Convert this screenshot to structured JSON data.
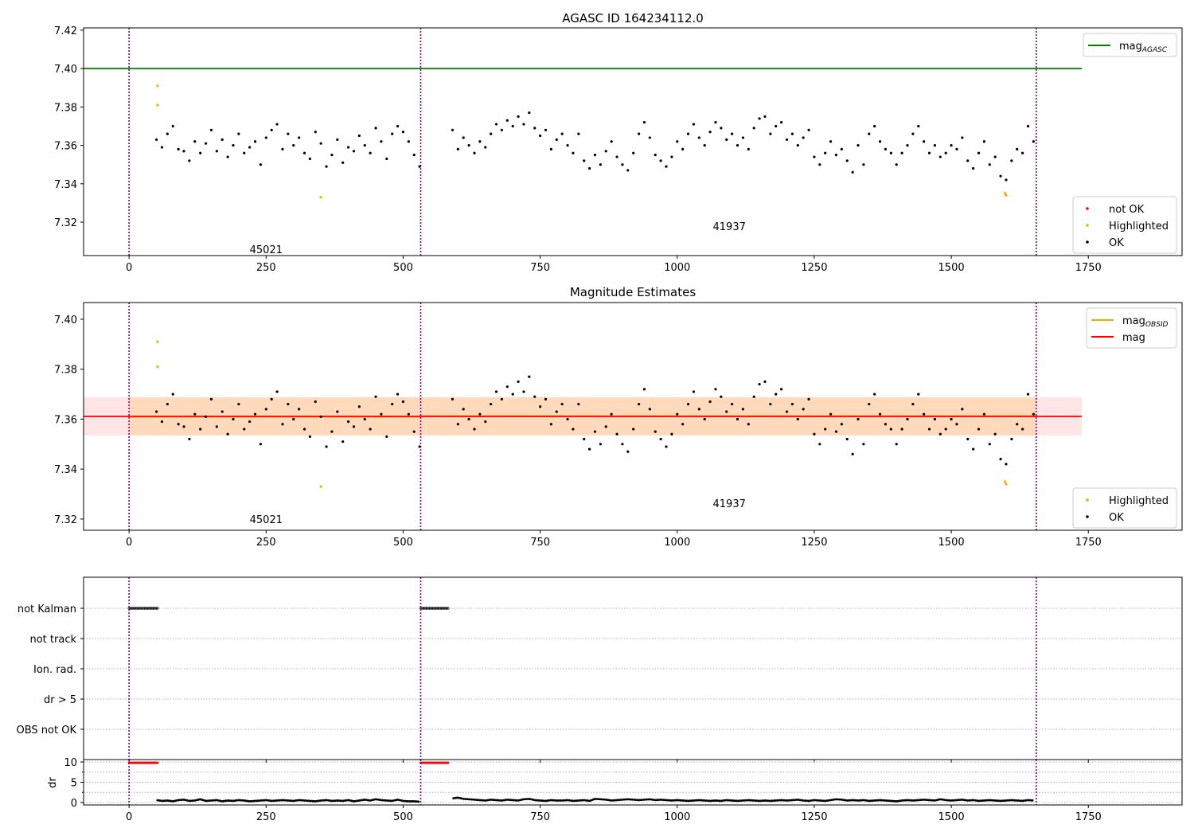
{
  "chart_data": {
    "type": "scatter",
    "xlim": [
      -83,
      1921
    ],
    "xticks": [
      0,
      250,
      500,
      750,
      1000,
      1250,
      1500,
      1750
    ],
    "obsid_boundaries": [
      0,
      532,
      1655
    ],
    "obsids": [
      {
        "id": "45021",
        "label_x": 250,
        "mag_obsid": 7.361,
        "x_start": 50,
        "x_step": 10,
        "mag": [
          7.363,
          7.359,
          7.366,
          7.37,
          7.358,
          7.357,
          7.352,
          7.362,
          7.356,
          7.361,
          7.368,
          7.357,
          7.363,
          7.354,
          7.36,
          7.366,
          7.356,
          7.359,
          7.362,
          7.35,
          7.364,
          7.368,
          7.371,
          7.358,
          7.366,
          7.36,
          7.364,
          7.356,
          7.353,
          7.367,
          7.361,
          7.349,
          7.355,
          7.363,
          7.351,
          7.359,
          7.357,
          7.365,
          7.36,
          7.356,
          7.369,
          7.362,
          7.353,
          7.366,
          7.37,
          7.367,
          7.362,
          7.355,
          7.349
        ],
        "dr": [
          0.6,
          0.4,
          0.5,
          0.3,
          0.6,
          0.7,
          0.4,
          0.5,
          0.8,
          0.4,
          0.5,
          0.6,
          0.3,
          0.5,
          0.4,
          0.6,
          0.5,
          0.3,
          0.4,
          0.5,
          0.6,
          0.4,
          0.5,
          0.6,
          0.5,
          0.4,
          0.6,
          0.5,
          0.4,
          0.3,
          0.5,
          0.6,
          0.4,
          0.5,
          0.4,
          0.6,
          0.3,
          0.5,
          0.7,
          0.5,
          0.8,
          0.6,
          0.5,
          0.4,
          0.7,
          0.4,
          0.3,
          0.3,
          0.2
        ],
        "not_kalman": [
          0,
          52
        ],
        "dr_clipped": [
          0,
          52
        ]
      },
      {
        "id": "41937",
        "label_x": 1095,
        "mag_obsid": 7.3612,
        "x_start": 590,
        "x_step": 10,
        "mag": [
          7.368,
          7.358,
          7.364,
          7.36,
          7.356,
          7.362,
          7.359,
          7.366,
          7.371,
          7.368,
          7.373,
          7.37,
          7.375,
          7.371,
          7.377,
          7.369,
          7.365,
          7.368,
          7.358,
          7.363,
          7.366,
          7.36,
          7.356,
          7.366,
          7.352,
          7.348,
          7.355,
          7.35,
          7.357,
          7.362,
          7.354,
          7.35,
          7.347,
          7.356,
          7.366,
          7.372,
          7.364,
          7.355,
          7.352,
          7.349,
          7.354,
          7.362,
          7.358,
          7.366,
          7.371,
          7.364,
          7.36,
          7.367,
          7.372,
          7.369,
          7.363,
          7.366,
          7.36,
          7.364,
          7.358,
          7.369,
          7.374,
          7.375,
          7.366,
          7.37,
          7.372,
          7.363,
          7.366,
          7.36,
          7.364,
          7.368,
          7.354,
          7.35,
          7.356,
          7.362,
          7.355,
          7.358,
          7.352,
          7.346,
          7.36,
          7.35,
          7.366,
          7.37,
          7.362,
          7.358,
          7.356,
          7.35,
          7.356,
          7.36,
          7.366,
          7.37,
          7.362,
          7.356,
          7.36,
          7.354,
          7.356,
          7.36,
          7.358,
          7.364,
          7.352,
          7.348,
          7.356,
          7.362,
          7.35,
          7.354,
          7.344,
          7.342,
          7.352,
          7.358,
          7.356,
          7.37,
          7.362
        ],
        "dr": [
          1.0,
          1.2,
          0.9,
          0.8,
          0.7,
          0.6,
          0.5,
          0.7,
          0.6,
          0.5,
          0.7,
          0.6,
          0.5,
          0.8,
          0.9,
          0.6,
          0.5,
          0.4,
          0.6,
          0.5,
          0.5,
          0.6,
          0.4,
          0.5,
          0.6,
          0.4,
          0.9,
          0.8,
          0.7,
          0.5,
          0.6,
          0.7,
          0.8,
          0.7,
          0.6,
          0.7,
          0.8,
          0.6,
          0.7,
          0.6,
          0.5,
          0.6,
          0.5,
          0.4,
          0.5,
          0.6,
          0.5,
          0.4,
          0.5,
          0.4,
          0.6,
          0.5,
          0.4,
          0.5,
          0.6,
          0.5,
          0.4,
          0.5,
          0.4,
          0.5,
          0.6,
          0.5,
          0.6,
          0.7,
          0.5,
          0.4,
          0.6,
          0.5,
          0.4,
          0.6,
          0.8,
          0.7,
          0.5,
          0.6,
          0.5,
          0.6,
          0.4,
          0.5,
          0.6,
          0.5,
          0.4,
          0.3,
          0.5,
          0.6,
          0.5,
          0.6,
          0.7,
          0.6,
          0.5,
          0.8,
          0.6,
          0.5,
          0.6,
          0.7,
          0.5,
          0.6,
          0.4,
          0.5,
          0.6,
          0.5,
          0.4,
          0.5,
          0.6,
          0.5,
          0.4,
          0.6,
          0.5
        ],
        "not_kalman": [
          532,
          582
        ],
        "dr_clipped": [
          532,
          582
        ]
      }
    ],
    "highlighted": [
      [
        52,
        7.391
      ],
      [
        52,
        7.381
      ],
      [
        350,
        7.333
      ],
      [
        1598,
        7.335
      ],
      [
        1600,
        7.334
      ]
    ],
    "panels": [
      {
        "title": "AGASC ID 164234112.0",
        "ylim": [
          7.3026,
          7.4212
        ],
        "yticks": [
          "7.32",
          "7.34",
          "7.36",
          "7.38",
          "7.40",
          "7.42"
        ],
        "mag_agasc": 7.4,
        "obsid_label_y": [
          7.306,
          7.318
        ],
        "legends": [
          [
            "mag",
            "AGASC"
          ],
          [
            "not OK",
            "Highlighted",
            "OK"
          ]
        ]
      },
      {
        "title": "Magnitude Estimates",
        "ylim": [
          7.3155,
          7.4067
        ],
        "yticks": [
          "7.32",
          "7.34",
          "7.36",
          "7.38",
          "7.40"
        ],
        "mag": 7.3611,
        "mag_band": [
          7.3535,
          7.3688
        ],
        "obsid_label_y": [
          7.32,
          7.3264
        ],
        "legends": [
          [
            "mag",
            "OBSID",
            "mag"
          ],
          [
            "Highlighted",
            "OK"
          ]
        ]
      },
      {
        "flags": [
          "not Kalman",
          "not track",
          "Ion. rad.",
          "dr > 5",
          "OBS not OK"
        ]
      },
      {
        "ylabel": "dr",
        "ylim": [
          -0.6,
          10.6
        ],
        "yticks": [
          "0",
          "5",
          "10"
        ]
      }
    ],
    "colors": {
      "ok": "#000000",
      "highlighted": "#ffa500",
      "not_ok": "#ff0000",
      "agasc": "#008000",
      "mag": "#ff0000",
      "mag_obsid": "#ffa500",
      "boundary": "#800080"
    }
  }
}
